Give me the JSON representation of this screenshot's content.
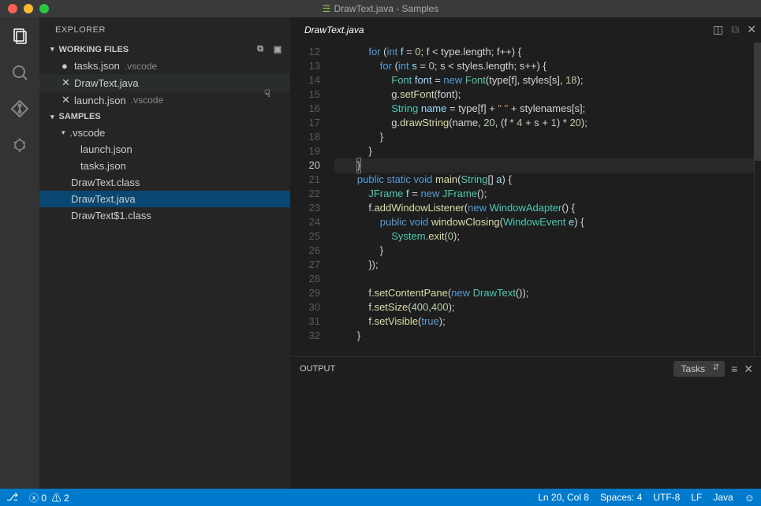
{
  "title": "DrawText.java - Samples",
  "sidebar": {
    "title": "EXPLORER",
    "workingFilesLabel": "WORKING FILES",
    "samplesLabel": "SAMPLES",
    "working": [
      {
        "name": "tasks.json",
        "dim": ".vscode",
        "dirty": true
      },
      {
        "name": "DrawText.java",
        "dim": "",
        "dirty": false,
        "hover": true
      },
      {
        "name": "launch.json",
        "dim": ".vscode",
        "dirty": false
      }
    ],
    "folder": {
      "name": ".vscode"
    },
    "folderFiles": [
      {
        "name": "launch.json"
      },
      {
        "name": "tasks.json"
      }
    ],
    "rootFiles": [
      {
        "name": "DrawText.class",
        "selected": false
      },
      {
        "name": "DrawText.java",
        "selected": true
      },
      {
        "name": "DrawText$1.class",
        "selected": false
      }
    ]
  },
  "tab": {
    "name": "DrawText.java"
  },
  "output": {
    "label": "OUTPUT",
    "select": "Tasks"
  },
  "status": {
    "errors": "0",
    "warnings": "2",
    "ln": "Ln 20, Col 8",
    "spaces": "Spaces: 4",
    "enc": "UTF-8",
    "eol": "LF",
    "lang": "Java"
  },
  "lines": {
    "start": 12,
    "count": 21,
    "cursorLine": 20
  },
  "code": [
    "            <span class='kw'>for</span> (<span class='kw'>int</span> <span class='vr'>f</span> = <span class='nm'>0</span>; f &lt; type.length; f++) {",
    "                <span class='kw'>for</span> (<span class='kw'>int</span> <span class='vr'>s</span> = <span class='nm'>0</span>; s &lt; styles.length; s++) {",
    "                    <span class='ty'>Font</span> <span class='vr'>font</span> = <span class='kw'>new</span> <span class='ty'>Font</span>(type[f], styles[s], <span class='nm'>18</span>);",
    "                    g.<span class='fn'>setFont</span>(font);",
    "                    <span class='ty'>String</span> <span class='vr'>name</span> = type[f] + <span class='st'>\" \"</span> + stylenames[s];",
    "                    g.<span class='fn'>drawString</span>(name, <span class='nm'>20</span>, (f * <span class='nm'>4</span> + s + <span class='nm'>1</span>) * <span class='nm'>20</span>);",
    "                }",
    "            }",
    "        <span class='cursor-box'>}</span>",
    "        <span class='kw'>public</span> <span class='kw'>static</span> <span class='kw'>void</span> <span class='fn'>main</span>(<span class='ty'>String</span>[] <span class='vr'>a</span>) {",
    "            <span class='ty'>JFrame</span> <span class='vr'>f</span> = <span class='kw'>new</span> <span class='ty'>JFrame</span>();",
    "            f.<span class='fn'>addWindowListener</span>(<span class='kw'>new</span> <span class='ty'>WindowAdapter</span>() {",
    "                <span class='kw'>public</span> <span class='kw'>void</span> <span class='fn'>windowClosing</span>(<span class='ty'>WindowEvent</span> <span class='vr'>e</span>) {",
    "                    <span class='ty'>System</span>.<span class='fn'>exit</span>(<span class='nm'>0</span>);",
    "                }",
    "            });",
    "            ",
    "            f.<span class='fn'>setContentPane</span>(<span class='kw'>new</span> <span class='ty'>DrawText</span>());",
    "            f.<span class='fn'>setSize</span>(<span class='nm'>400</span>,<span class='nm'>400</span>);",
    "            f.<span class='fn'>setVisible</span>(<span class='kw'>true</span>);",
    "        }"
  ]
}
